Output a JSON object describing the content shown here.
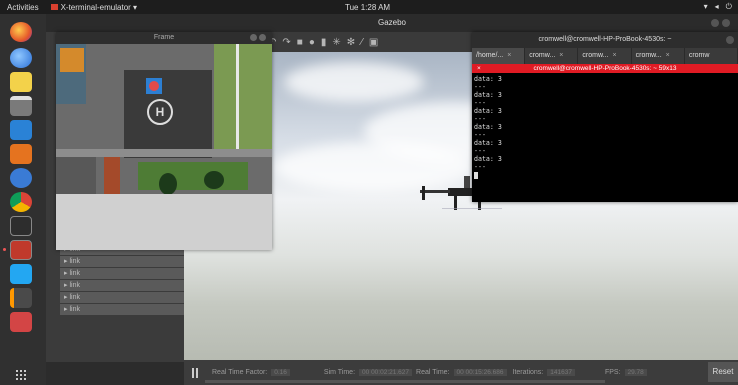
{
  "topbar": {
    "activities": "Activities",
    "app_menu": "X-terminal-emulator ▾",
    "clock": "Tue  1:28 AM",
    "status_icons": [
      "network-icon",
      "volume-icon",
      "power-icon"
    ]
  },
  "gazebo": {
    "title": "Gazebo",
    "frame_window_title": "Frame",
    "tree_links": [
      "link",
      "link",
      "link",
      "link",
      "link",
      "link"
    ],
    "toolbar_icons": [
      "undo-icon",
      "redo-icon",
      "box-shape-icon",
      "sphere-shape-icon",
      "cylinder-shape-icon",
      "sun-light-icon",
      "point-light-icon",
      "spot-light-icon",
      "screenshot-icon"
    ],
    "bottom": {
      "real_time_factor_label": "Real Time Factor:",
      "real_time_factor": "0.16",
      "sim_time_label": "Sim Time:",
      "sim_time": "00 00:02:21.627",
      "real_time_label": "Real Time:",
      "real_time": "00 00:15:26.686",
      "iterations_label": "Iterations:",
      "iterations": "141637",
      "fps_label": "FPS:",
      "fps": "29.78",
      "reset": "Reset"
    }
  },
  "terminal": {
    "window_title": "cromwell@cromwell-HP-ProBook-4530s: ~",
    "tabs": [
      {
        "label": "/home/...",
        "close": "×"
      },
      {
        "label": "cromw...",
        "close": "×"
      },
      {
        "label": "cromw...",
        "close": "×"
      },
      {
        "label": "cromw...",
        "close": "×"
      },
      {
        "label": "cromw",
        "close": ""
      }
    ],
    "active_title": "cromwell@cromwell-HP-ProBook-4530s: ~ 59x13",
    "close_x": "×",
    "lines": [
      "data: 3",
      "---",
      "data: 3",
      "---",
      "data: 3",
      "---",
      "data: 3",
      "---",
      "data: 3",
      "---",
      "data: 3",
      "---"
    ]
  },
  "colors": {
    "terminal_active_bar": "#e01b24",
    "topbar": "#1d1d1d",
    "dock": "#303030"
  }
}
